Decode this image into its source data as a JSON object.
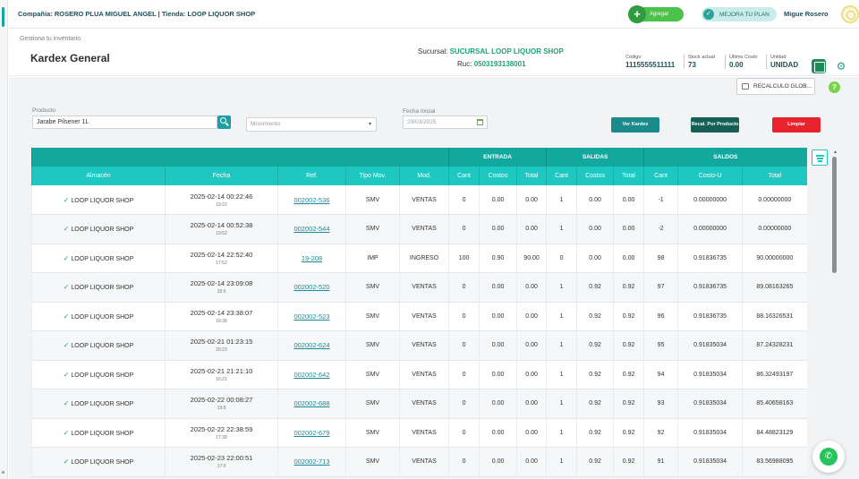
{
  "topbar": {
    "company": "Compañía: ROSERO PLUA MIGUEL ANGEL | Tienda: LOOP LIQUOR SHOP",
    "agregar_label": "Agregar",
    "mejora_label": "MEJORA TU PLAN",
    "user_name": "Migue Rosero"
  },
  "header": {
    "breadcrumb": "Gestiona tu inventario",
    "title": "Kardex General",
    "sucursal_label": "Sucursal:",
    "sucursal_value": "SUCURSAL LOOP LIQUOR SHOP",
    "ruc_label": "Ruc:",
    "ruc_value": "0503193138001",
    "stats": [
      {
        "label": "Código",
        "value": "1115555511111"
      },
      {
        "label": "Stock actual",
        "value": "73"
      },
      {
        "label": "Último Costo",
        "value": "0.00"
      },
      {
        "label": "Unidad",
        "value": "UNIDAD"
      }
    ],
    "excel_label": "X"
  },
  "toolbar": {
    "recalculo_global": "RECALCULO GLOB...",
    "help_label": "?"
  },
  "filters": {
    "producto_label": "Producto",
    "producto_value": "Jarabe Pilsener 1L",
    "movimiento_placeholder": "Movimiento",
    "fecha_label": "Fecha Inicial",
    "fecha_value": "29/03/2025",
    "ver_kardex": "Ver Kardex",
    "recal_producto": "Recal. Por Producto",
    "limpiar": "Limpiar"
  },
  "table": {
    "groups": {
      "entrada": "ENTRADA",
      "salidas": "SALIDAS",
      "saldos": "SALDOS"
    },
    "columns": [
      "Almacén",
      "Fecha",
      "Ref.",
      "Tipo Mov.",
      "Mod.",
      "Cant",
      "Costos",
      "Total",
      "Cant",
      "Costos",
      "Total",
      "Cant",
      "Costo-U",
      "Total"
    ],
    "rows": [
      {
        "almacen": "LOOP LIQUOR SHOP",
        "fecha": "2025-02-14 00:22:46",
        "hora": "19:22",
        "ref": "002002-536",
        "tipo": "SMV",
        "mod": "VENTAS",
        "e_cant": "0",
        "e_costo": "0.00",
        "e_total": "0.00",
        "s_cant": "1",
        "s_costo": "0.00",
        "s_total": "0.00",
        "sa_cant": "-1",
        "sa_costo": "0.00000000",
        "sa_total": "0.00000000"
      },
      {
        "almacen": "LOOP LIQUOR SHOP",
        "fecha": "2025-02-14 00:52:38",
        "hora": "19:52",
        "ref": "002002-544",
        "tipo": "SMV",
        "mod": "VENTAS",
        "e_cant": "0",
        "e_costo": "0.00",
        "e_total": "0.00",
        "s_cant": "1",
        "s_costo": "0.00",
        "s_total": "0.00",
        "sa_cant": "-2",
        "sa_costo": "0.00000000",
        "sa_total": "0.00000000"
      },
      {
        "almacen": "LOOP LIQUOR SHOP",
        "fecha": "2025-02-14 22:52:40",
        "hora": "17:52",
        "ref": "19-208",
        "tipo": "IMP",
        "mod": "INGRESO",
        "e_cant": "100",
        "e_costo": "0.90",
        "e_total": "90.00",
        "s_cant": "0",
        "s_costo": "0.00",
        "s_total": "0.00",
        "sa_cant": "98",
        "sa_costo": "0.91836735",
        "sa_total": "90.00000000"
      },
      {
        "almacen": "LOOP LIQUOR SHOP",
        "fecha": "2025-02-14 23:09:08",
        "hora": "18:9",
        "ref": "002002-520",
        "tipo": "SMV",
        "mod": "VENTAS",
        "e_cant": "0",
        "e_costo": "0.00",
        "e_total": "0.00",
        "s_cant": "1",
        "s_costo": "0.92",
        "s_total": "0.92",
        "sa_cant": "97",
        "sa_costo": "0.91836735",
        "sa_total": "89.08163265"
      },
      {
        "almacen": "LOOP LIQUOR SHOP",
        "fecha": "2025-02-14 23:38:07",
        "hora": "18:38",
        "ref": "002002-523",
        "tipo": "SMV",
        "mod": "VENTAS",
        "e_cant": "0",
        "e_costo": "0.00",
        "e_total": "0.00",
        "s_cant": "1",
        "s_costo": "0.92",
        "s_total": "0.92",
        "sa_cant": "96",
        "sa_costo": "0.91836735",
        "sa_total": "88.16326531"
      },
      {
        "almacen": "LOOP LIQUOR SHOP",
        "fecha": "2025-02-21 01:23:15",
        "hora": "20:23",
        "ref": "002002-624",
        "tipo": "SMV",
        "mod": "VENTAS",
        "e_cant": "0",
        "e_costo": "0.00",
        "e_total": "0.00",
        "s_cant": "1",
        "s_costo": "0.92",
        "s_total": "0.92",
        "sa_cant": "95",
        "sa_costo": "0.91835034",
        "sa_total": "87.24328231"
      },
      {
        "almacen": "LOOP LIQUOR SHOP",
        "fecha": "2025-02-21 21:21:10",
        "hora": "16:21",
        "ref": "002002-642",
        "tipo": "SMV",
        "mod": "VENTAS",
        "e_cant": "0",
        "e_costo": "0.00",
        "e_total": "0.00",
        "s_cant": "1",
        "s_costo": "0.92",
        "s_total": "0.92",
        "sa_cant": "94",
        "sa_costo": "0.91835034",
        "sa_total": "86.32493197"
      },
      {
        "almacen": "LOOP LIQUOR SHOP",
        "fecha": "2025-02-22 00:08:27",
        "hora": "19:8",
        "ref": "002002-688",
        "tipo": "SMV",
        "mod": "VENTAS",
        "e_cant": "0",
        "e_costo": "0.00",
        "e_total": "0.00",
        "s_cant": "1",
        "s_costo": "0.92",
        "s_total": "0.92",
        "sa_cant": "93",
        "sa_costo": "0.91835034",
        "sa_total": "85.40658163"
      },
      {
        "almacen": "LOOP LIQUOR SHOP",
        "fecha": "2025-02-22 22:38:59",
        "hora": "17:38",
        "ref": "002002-679",
        "tipo": "SMV",
        "mod": "VENTAS",
        "e_cant": "0",
        "e_costo": "0.00",
        "e_total": "0.00",
        "s_cant": "1",
        "s_costo": "0.92",
        "s_total": "0.92",
        "sa_cant": "92",
        "sa_costo": "0.91835034",
        "sa_total": "84.48823129"
      },
      {
        "almacen": "LOOP LIQUOR SHOP",
        "fecha": "2025-02-23 22:00:51",
        "hora": "17:0",
        "ref": "002002-713",
        "tipo": "SMV",
        "mod": "VENTAS",
        "e_cant": "0",
        "e_costo": "0.00",
        "e_total": "0.00",
        "s_cant": "1",
        "s_costo": "0.92",
        "s_total": "0.92",
        "sa_cant": "91",
        "sa_costo": "0.91835034",
        "sa_total": "83.56988095"
      }
    ]
  },
  "colors": {
    "teal_header": "#12a89d",
    "teal_columns": "#1ec7c0",
    "accent_green": "#1aa37a",
    "danger": "#e8232e"
  }
}
